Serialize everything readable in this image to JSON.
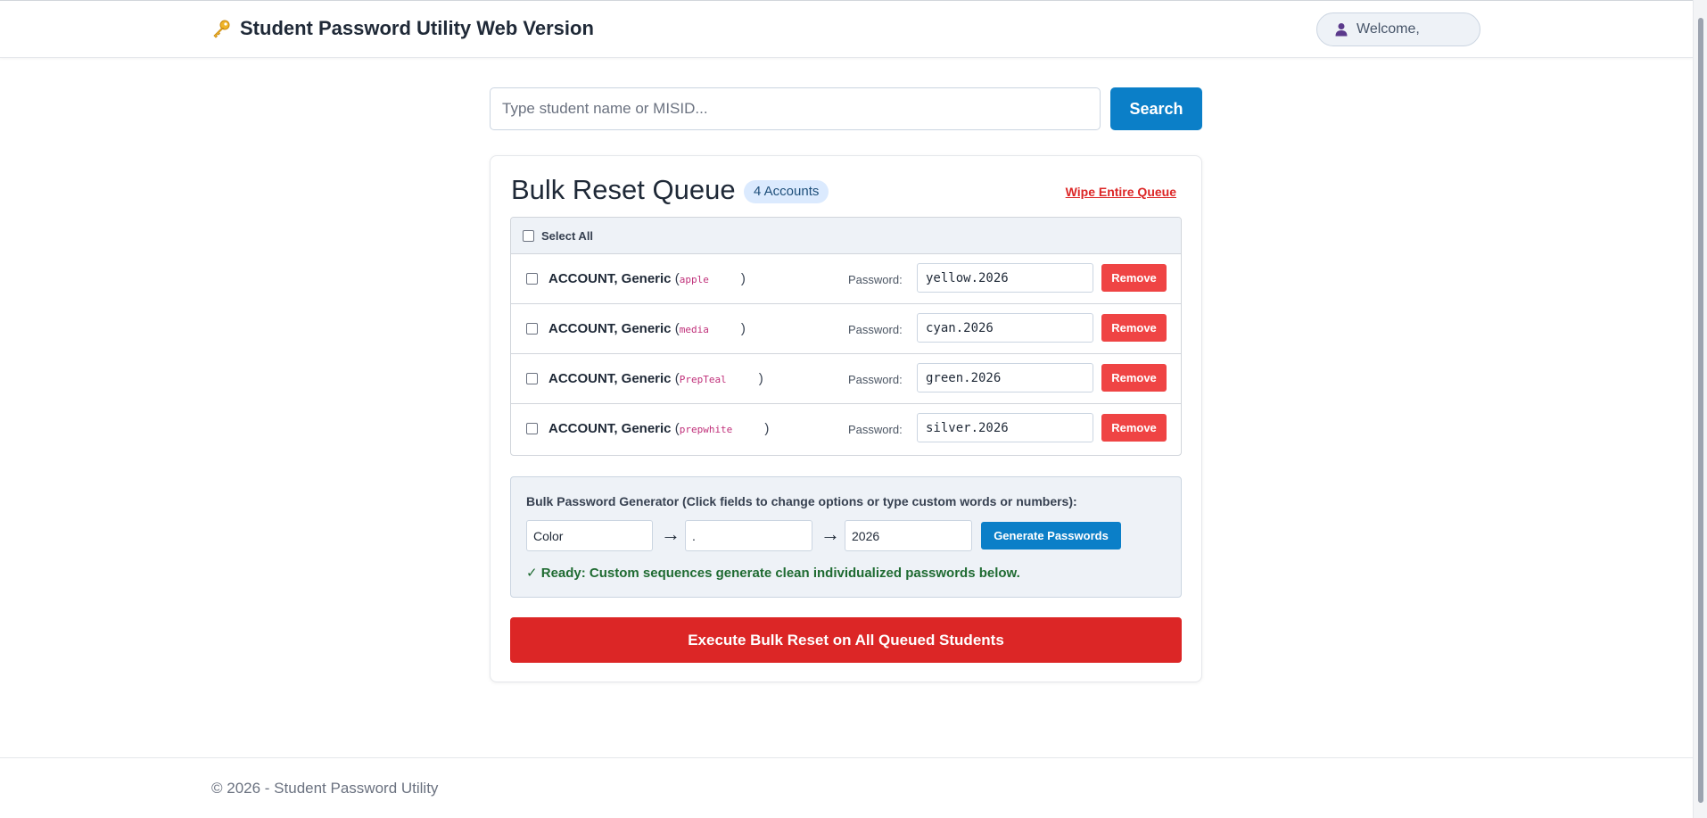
{
  "header": {
    "title": "Student Password Utility Web Version",
    "brand_icon": "key-icon",
    "user": {
      "label": "Welcome,",
      "icon": "user-icon"
    }
  },
  "search": {
    "placeholder": "Type student name or MISID...",
    "value": "",
    "button_label": "Search"
  },
  "queue": {
    "title": "Bulk Reset Queue",
    "count_badge": "4 Accounts",
    "wipe_label": "Wipe Entire Queue",
    "select_all_label": "Select All",
    "password_label": "Password:",
    "remove_label": "Remove",
    "rows": [
      {
        "name": "ACCOUNT, Generic",
        "open": "(",
        "misid": "apple",
        "close": ")",
        "password": "yellow.2026",
        "checked": false
      },
      {
        "name": "ACCOUNT, Generic",
        "open": "(",
        "misid": "media",
        "close": ")",
        "password": "cyan.2026",
        "checked": false
      },
      {
        "name": "ACCOUNT, Generic",
        "open": "(",
        "misid": "PrepTeal",
        "close": ")",
        "password": "green.2026",
        "checked": false
      },
      {
        "name": "ACCOUNT, Generic",
        "open": "(",
        "misid": "prepwhite",
        "close": ")",
        "password": "silver.2026",
        "checked": false
      }
    ]
  },
  "generator": {
    "title": "Bulk Password Generator (Click fields to change options or type custom words or numbers):",
    "field1": "Color",
    "arrow": "→",
    "field2": ".",
    "field3": "2026",
    "button_label": "Generate Passwords",
    "status": "✓ Ready: Custom sequences generate clean individualized passwords below."
  },
  "execute_label": "Execute Bulk Reset on All Queued Students",
  "footer": {
    "text": "© 2026 - Student Password Utility"
  },
  "colors": {
    "primary": "#0b7fc8",
    "danger": "#dc2626",
    "remove": "#ef4444",
    "success": "#1f6b32",
    "badge_bg": "#dbeafe"
  }
}
